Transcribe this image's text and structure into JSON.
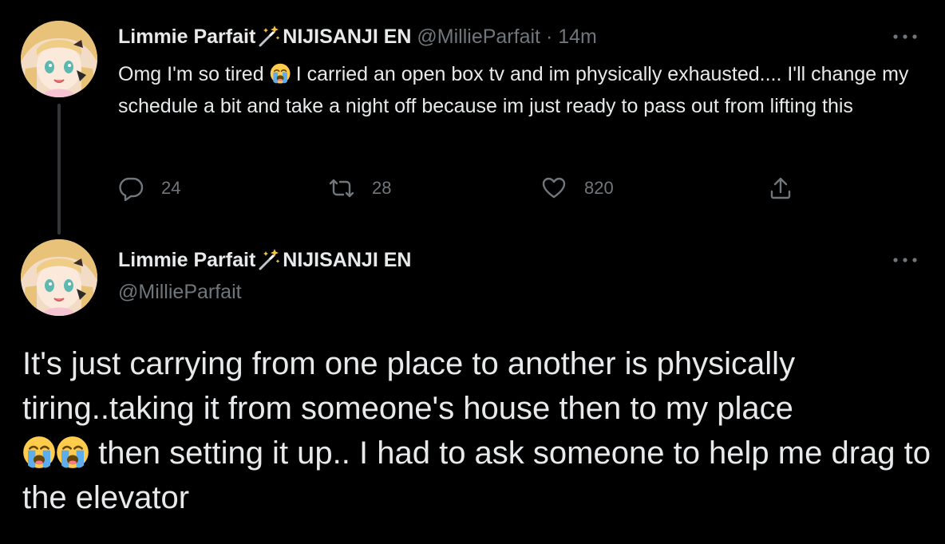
{
  "tweet1": {
    "display_name": "Limmie Parfait",
    "affiliation": "NIJISANJI EN",
    "handle": "@MillieParfait",
    "separator": "·",
    "time": "14m",
    "text_before_emoji": "Omg I'm so tired",
    "emoji_name": "loudly-crying-face",
    "text_after_emoji": "I carried an open box tv and im physically exhausted.... I'll change my schedule a bit and take a night off because im just ready to pass out from lifting this",
    "actions": {
      "reply_count": "24",
      "retweet_count": "28",
      "like_count": "820"
    }
  },
  "tweet2": {
    "display_name": "Limmie Parfait",
    "affiliation": "NIJISANJI EN",
    "handle": "@MillieParfait",
    "text_part1": "It's just carrying from one place to another is physically tiring..taking it from someone's house then to my place",
    "emoji_name": "loudly-crying-face",
    "text_part2": "then setting it up.. I had to ask someone to help me drag to the elevator"
  },
  "colors": {
    "background": "#000000",
    "primary_text": "#e7e9ea",
    "secondary_text": "#71767b",
    "thread_line": "#333639"
  }
}
